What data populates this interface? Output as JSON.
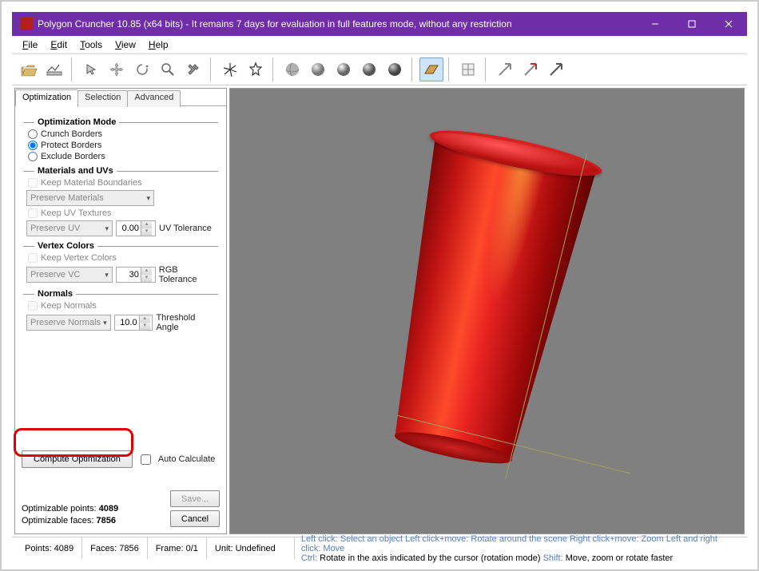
{
  "title": "Polygon Cruncher 10.85 (x64 bits) - It remains 7 days for evaluation in full features mode, without any restriction",
  "menu": {
    "file": "File",
    "edit": "Edit",
    "tools": "Tools",
    "view": "View",
    "help": "Help"
  },
  "tabs": {
    "optimization": "Optimization",
    "selection": "Selection",
    "advanced": "Advanced"
  },
  "opt_mode": {
    "label": "Optimization Mode",
    "crunch": "Crunch Borders",
    "protect": "Protect Borders",
    "exclude": "Exclude Borders"
  },
  "materials_uvs": {
    "label": "Materials and UVs",
    "keep_material_boundaries": "Keep Material Boundaries",
    "preserve_materials": "Preserve Materials",
    "keep_uv_textures": "Keep UV Textures",
    "preserve_uv": "Preserve UV",
    "uv_tol_value": "0.00",
    "uv_tol_label": "UV Tolerance"
  },
  "vertex_colors": {
    "label": "Vertex Colors",
    "keep_vertex_colors": "Keep Vertex Colors",
    "preserve_vc": "Preserve VC",
    "rgb_tol_value": "30",
    "rgb_tol_label": "RGB Tolerance"
  },
  "normals": {
    "label": "Normals",
    "keep_normals": "Keep Normals",
    "preserve_normals": "Preserve Normals",
    "threshold_value": "10.0",
    "threshold_label": "Threshold Angle"
  },
  "compute_btn": "Compute Optimization",
  "auto_calculate": "Auto Calculate",
  "stats": {
    "points_label": "Optimizable points:",
    "points_value": "4089",
    "faces_label": "Optimizable faces:",
    "faces_value": "7856"
  },
  "save_btn": "Save...",
  "cancel_btn": "Cancel",
  "status": {
    "points": "Points: 4089",
    "faces": "Faces: 7856",
    "frame": "Frame: 0/1",
    "unit": "Unit: Undefined",
    "hint_leftclick": "Left click:",
    "hint_leftclick_act": "Select an object",
    "hint_leftmove": "Left click+move:",
    "hint_leftmove_act": "Rotate around the scene",
    "hint_rightmove": "Right click+move:",
    "hint_rightmove_act": "Zoom",
    "hint_lr": "Left and right click:",
    "hint_lr_act": "Move",
    "hint_ctrl": "Ctrl:",
    "hint_ctrl_txt": "Rotate in the axis indicated by the cursor (rotation mode)",
    "hint_shift": "Shift:",
    "hint_shift_txt": "Move, zoom or rotate faster"
  }
}
